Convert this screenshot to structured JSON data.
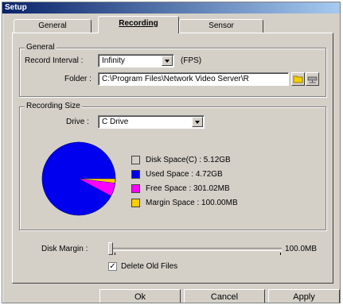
{
  "window": {
    "title": "Setup"
  },
  "tabs": [
    {
      "label": "General"
    },
    {
      "label": "Recording",
      "active": true
    },
    {
      "label": "Sensor"
    }
  ],
  "general_group": {
    "title": "General",
    "record_interval": {
      "label": "Record Interval :",
      "value": "Infinity",
      "unit": "(FPS)"
    },
    "folder": {
      "label": "Folder :",
      "value": "C:\\Program Files\\Network Video Server\\R"
    }
  },
  "recording_size": {
    "title": "Recording Size",
    "drive": {
      "label": "Drive :",
      "value": "C Drive"
    },
    "legend": [
      {
        "label": "Disk Space(C) : 5.12GB",
        "color": "#d4d0c8"
      },
      {
        "label": "Used Space : 4.72GB",
        "color": "#0000ee"
      },
      {
        "label": "Free Space : 301.02MB",
        "color": "#ff00ff"
      },
      {
        "label": "Margin Space : 100.00MB",
        "color": "#ffcc00"
      }
    ]
  },
  "pie": {
    "used_fraction": 0.922,
    "free_fraction": 0.059,
    "margin_fraction": 0.019,
    "used_color": "#0000ee",
    "free_color": "#ff00ff",
    "margin_color": "#ffcc00"
  },
  "disk_margin": {
    "label": "Disk Margin :",
    "value": "100.0MB",
    "level": 0.0
  },
  "delete_old_files": {
    "label": "Delete Old Files",
    "checked": true,
    "mark": "✓"
  },
  "buttons": {
    "ok": "Ok",
    "cancel": "Cancel",
    "apply": "Apply"
  }
}
